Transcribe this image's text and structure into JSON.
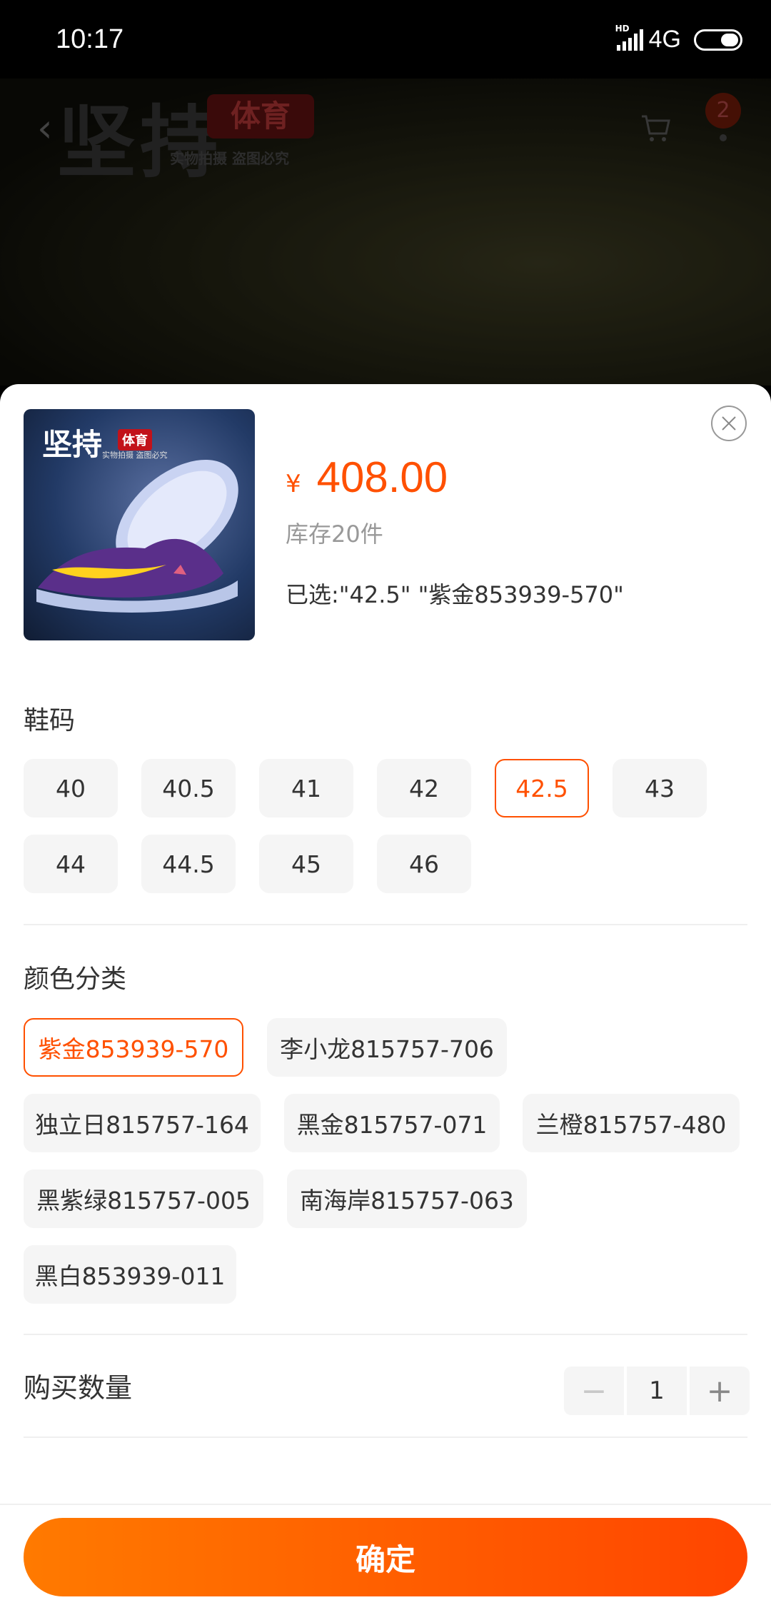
{
  "status_bar": {
    "time": "10:17",
    "hd": "HD",
    "network": "4G"
  },
  "header": {
    "watermark_main": "坚持",
    "watermark_badge": "体育",
    "watermark_sub": "实物拍摄 盗图必究",
    "cart_count": "2"
  },
  "product": {
    "thumb_logo": "坚持",
    "thumb_logo_badge": "体育",
    "thumb_logo_sub": "实物拍摄 盗图必究",
    "currency": "¥",
    "price": "408.00",
    "stock": "库存20件",
    "selected": "已选:\"42.5\" \"紫金853939-570\""
  },
  "size": {
    "title": "鞋码",
    "options": [
      "40",
      "40.5",
      "41",
      "42",
      "42.5",
      "43",
      "44",
      "44.5",
      "45",
      "46"
    ],
    "selected": "42.5"
  },
  "color": {
    "title": "颜色分类",
    "options": [
      "紫金853939-570",
      "李小龙815757-706",
      "独立日815757-164",
      "黑金815757-071",
      "兰橙815757-480",
      "黑紫绿815757-005",
      "南海岸815757-063",
      "黑白853939-011"
    ],
    "selected": "紫金853939-570"
  },
  "quantity": {
    "label": "购买数量",
    "minus": "−",
    "value": "1",
    "plus": "+"
  },
  "footer": {
    "confirm_label": "确定"
  },
  "colors": {
    "accent": "#ff5000",
    "chip_bg": "#f5f5f5"
  }
}
